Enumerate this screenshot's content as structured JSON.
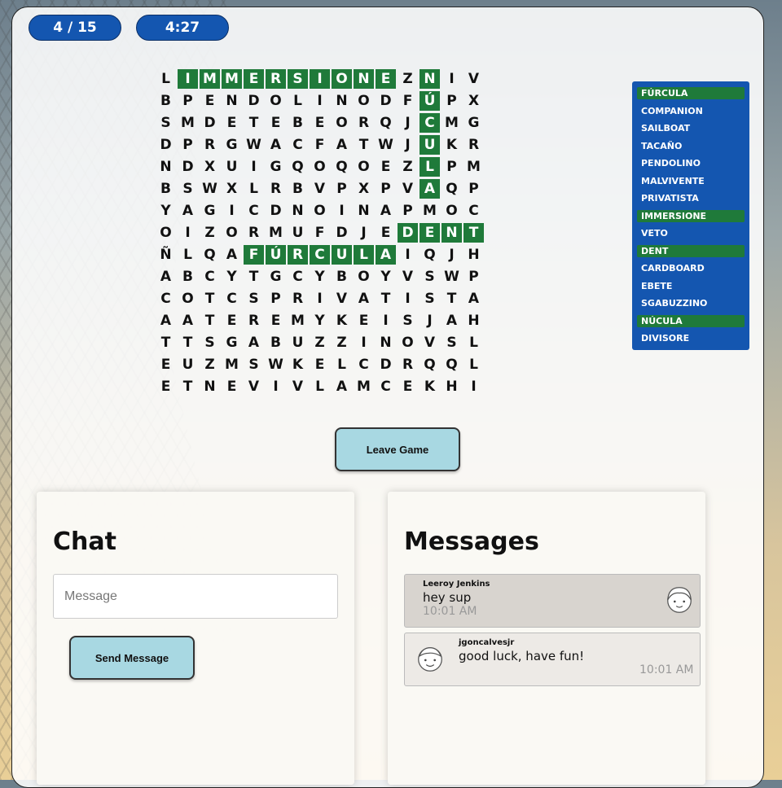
{
  "header": {
    "score": "4 / 15",
    "timer": "4:27"
  },
  "grid": [
    "LIMMERSIONEZNIV",
    "BPENDOLINODFÚPX",
    "SMDETEBEORQJCMG",
    "DPRGWACFATWJUKR",
    "NDXUIGQOQOEZLPM",
    "BSWXLRBVPXPVAQP",
    "YAGICDNOINAPMOC",
    "OIZORMUFDJEDENT",
    "ÑLQAFÚRCULAIQJH",
    "ABCYTGCYBOYVSWP",
    "COTCSPRIVATISTA",
    "AATEREMYKEISJAH",
    "TTSGABUZZINOVSL",
    "EUZMSWKELCDRQQL",
    "ETNEVIVLAMCEKHI"
  ],
  "found_cells": [
    [
      0,
      1
    ],
    [
      0,
      2
    ],
    [
      0,
      3
    ],
    [
      0,
      4
    ],
    [
      0,
      5
    ],
    [
      0,
      6
    ],
    [
      0,
      7
    ],
    [
      0,
      8
    ],
    [
      0,
      9
    ],
    [
      0,
      10
    ],
    [
      0,
      12
    ],
    [
      1,
      12
    ],
    [
      2,
      12
    ],
    [
      3,
      12
    ],
    [
      4,
      12
    ],
    [
      5,
      12
    ],
    [
      7,
      11
    ],
    [
      7,
      12
    ],
    [
      7,
      13
    ],
    [
      7,
      14
    ],
    [
      8,
      4
    ],
    [
      8,
      5
    ],
    [
      8,
      6
    ],
    [
      8,
      7
    ],
    [
      8,
      8
    ],
    [
      8,
      9
    ],
    [
      8,
      10
    ]
  ],
  "words": [
    {
      "label": "FÚRCULA",
      "found": true
    },
    {
      "label": "COMPANION",
      "found": false
    },
    {
      "label": "SAILBOAT",
      "found": false
    },
    {
      "label": "TACAÑO",
      "found": false
    },
    {
      "label": "PENDOLINO",
      "found": false
    },
    {
      "label": "MALVIVENTE",
      "found": false
    },
    {
      "label": "PRIVATISTA",
      "found": false
    },
    {
      "label": "IMMERSIONE",
      "found": true
    },
    {
      "label": "VETO",
      "found": false
    },
    {
      "label": "DENT",
      "found": true
    },
    {
      "label": "CARDBOARD",
      "found": false
    },
    {
      "label": "EBETE",
      "found": false
    },
    {
      "label": "SGABUZZINO",
      "found": false
    },
    {
      "label": "NÚCULA",
      "found": true
    },
    {
      "label": "DIVISORE",
      "found": false
    }
  ],
  "leave_label": "Leave Game",
  "chat": {
    "title": "Chat",
    "placeholder": "Message",
    "send_label": "Send Message"
  },
  "messages": {
    "title": "Messages",
    "items": [
      {
        "author": "Leeroy Jenkins",
        "text": "hey sup",
        "time": "10:01 AM",
        "avatar": "girl-face-icon"
      },
      {
        "author": "jgoncalvesjr",
        "text": "good luck, have fun!",
        "time": "10:01 AM",
        "avatar": "boy-face-icon"
      }
    ]
  },
  "colors": {
    "accent": "#1456b0",
    "found": "#1f7a3a",
    "button": "#a8d8e2"
  }
}
